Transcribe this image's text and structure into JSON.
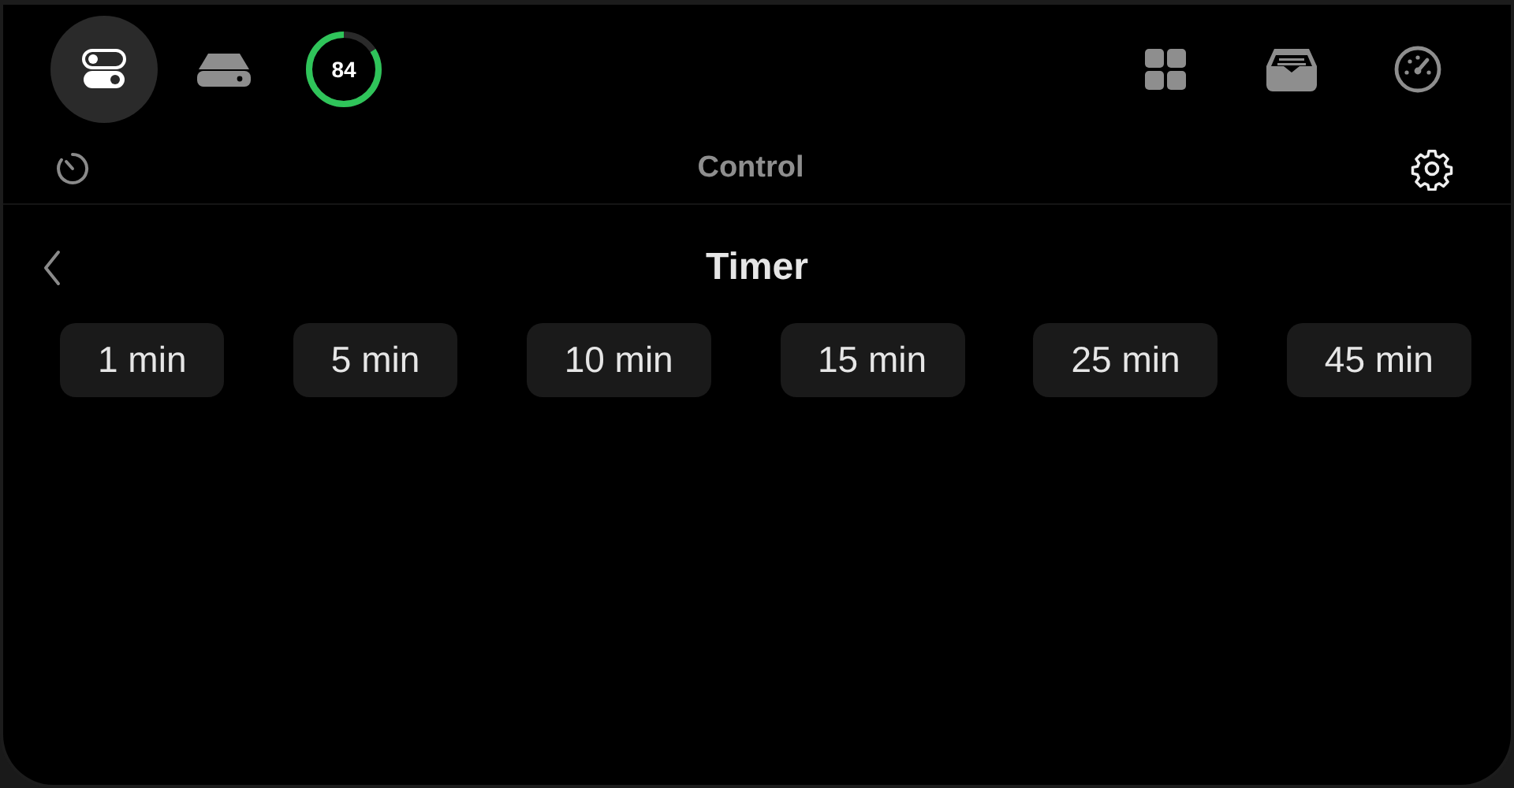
{
  "tabs_left": [
    {
      "kind": "toggles",
      "selected": true
    },
    {
      "kind": "drive",
      "selected": false
    },
    {
      "kind": "ring",
      "value": "84",
      "selected": false
    }
  ],
  "tabs_right": [
    {
      "kind": "grid",
      "selected": false
    },
    {
      "kind": "tray",
      "selected": false
    },
    {
      "kind": "gauge",
      "selected": false
    }
  ],
  "header": {
    "title": "Control"
  },
  "panel": {
    "title": "Timer",
    "options": [
      {
        "label": "1 min"
      },
      {
        "label": "5 min"
      },
      {
        "label": "10 min"
      },
      {
        "label": "15 min"
      },
      {
        "label": "25 min"
      },
      {
        "label": "45 min"
      }
    ]
  }
}
